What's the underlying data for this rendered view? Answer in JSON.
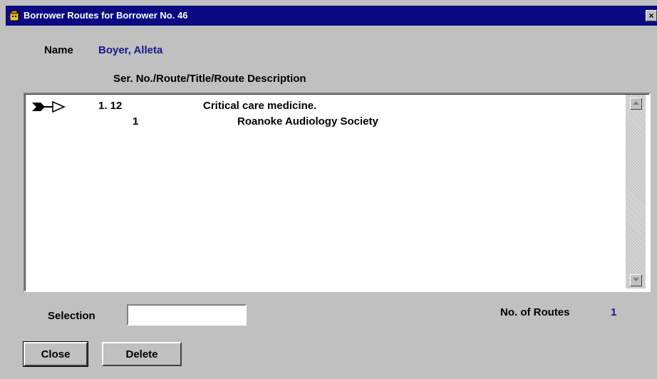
{
  "window": {
    "title": "Borrower Routes for Borrower No. 46",
    "close_glyph": "×",
    "icon": "folder-app-icon"
  },
  "form": {
    "name_label": "Name",
    "name_value": "Boyer, Alleta",
    "column_header": "Ser. No./Route/Title/Route Description"
  },
  "list": {
    "rows": [
      {
        "serial": "1. 12",
        "title": "Critical care medicine.",
        "route": "1",
        "route_description": "Roanoke Audiology Society",
        "selected_marker": "arrow-pointer-icon"
      }
    ]
  },
  "footer": {
    "selection_label": "Selection",
    "selection_value": "",
    "routes_label": "No. of Routes",
    "routes_count": "1",
    "close_button": "Close",
    "delete_button": "Delete"
  },
  "colors": {
    "titlebar": "#0a0a82",
    "value_text": "#1a1a8c",
    "dialog_bg": "#c0c0c0"
  }
}
